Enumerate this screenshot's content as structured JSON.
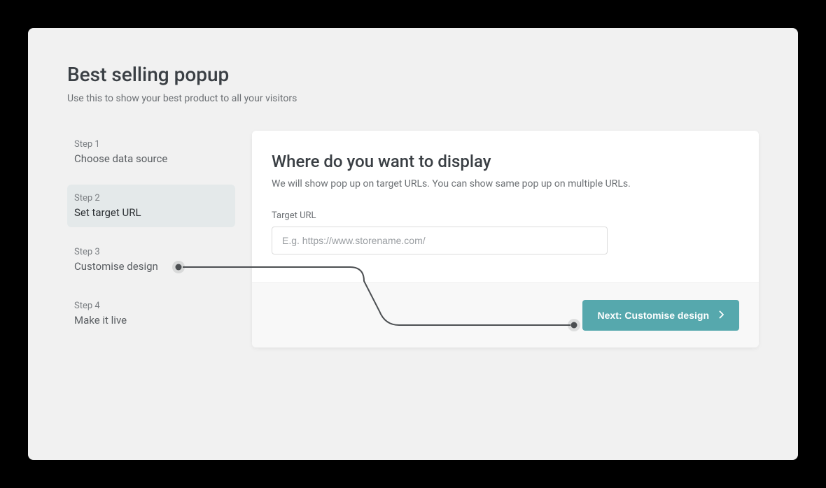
{
  "header": {
    "title": "Best selling popup",
    "subtitle": "Use this to show your best product to all your visitors"
  },
  "steps": [
    {
      "label": "Step 1",
      "title": "Choose data source"
    },
    {
      "label": "Step 2",
      "title": "Set target URL"
    },
    {
      "label": "Step 3",
      "title": "Customise design"
    },
    {
      "label": "Step 4",
      "title": "Make it live"
    }
  ],
  "panel": {
    "title": "Where do you want to display",
    "description": "We will show pop up on target URLs. You can show same pop up on multiple URLs.",
    "field_label": "Target URL",
    "placeholder": "E.g. https://www.storename.com/",
    "value": ""
  },
  "footer": {
    "next_label": "Next: Customise design"
  },
  "colors": {
    "accent": "#56a8ad"
  }
}
